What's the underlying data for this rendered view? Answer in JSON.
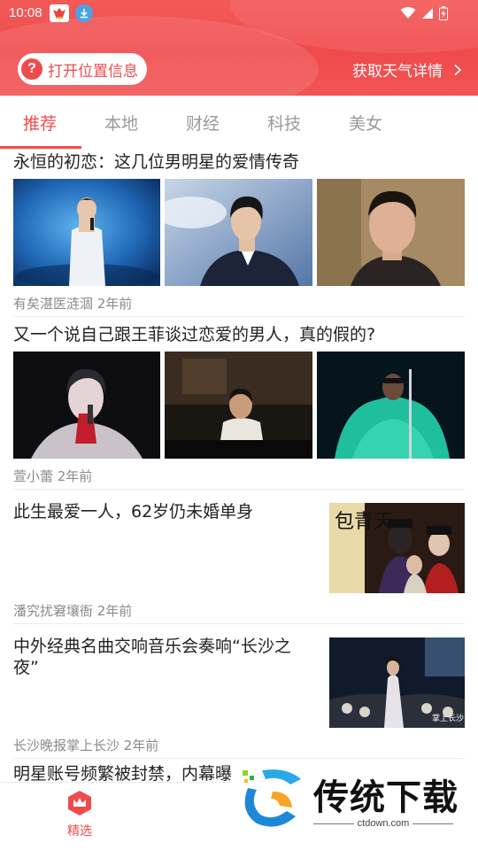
{
  "status_bar": {
    "time": "10:08"
  },
  "header": {
    "location_button": "打开位置信息",
    "location_icon_glyph": "?",
    "weather_link": "获取天气详情"
  },
  "tabs": [
    "推荐",
    "本地",
    "财经",
    "科技",
    "美女"
  ],
  "active_tab": "推荐",
  "feed": [
    {
      "title": "永恒的初恋：这几位男明星的爱情传奇",
      "meta": "有矣湛医涟涸 2年前"
    },
    {
      "title": "又一个说自己跟王菲谈过恋爱的男人，真的假的?",
      "meta": "萱小蕾 2年前"
    },
    {
      "title": "此生最爱一人，62岁仍未婚单身",
      "meta": "潘究扰窘壤衙 2年前",
      "thumb_text": "包青天"
    },
    {
      "title_line1": "中外经典名曲交响音乐会奏响“长沙之",
      "title_line2": "夜”",
      "meta": "长沙晚报掌上长沙 2年前",
      "thumb_text": "掌上长沙"
    },
    {
      "title": "明星账号频繁被封禁，内幕曝"
    }
  ],
  "bottom_nav": [
    {
      "label": "精选",
      "icon": "crown-icon",
      "active": true
    }
  ],
  "watermark": {
    "text": "传统下载",
    "url": "ctdown.com"
  },
  "colors": {
    "accent": "#ef4b4c",
    "meta": "#8a8a8a"
  }
}
